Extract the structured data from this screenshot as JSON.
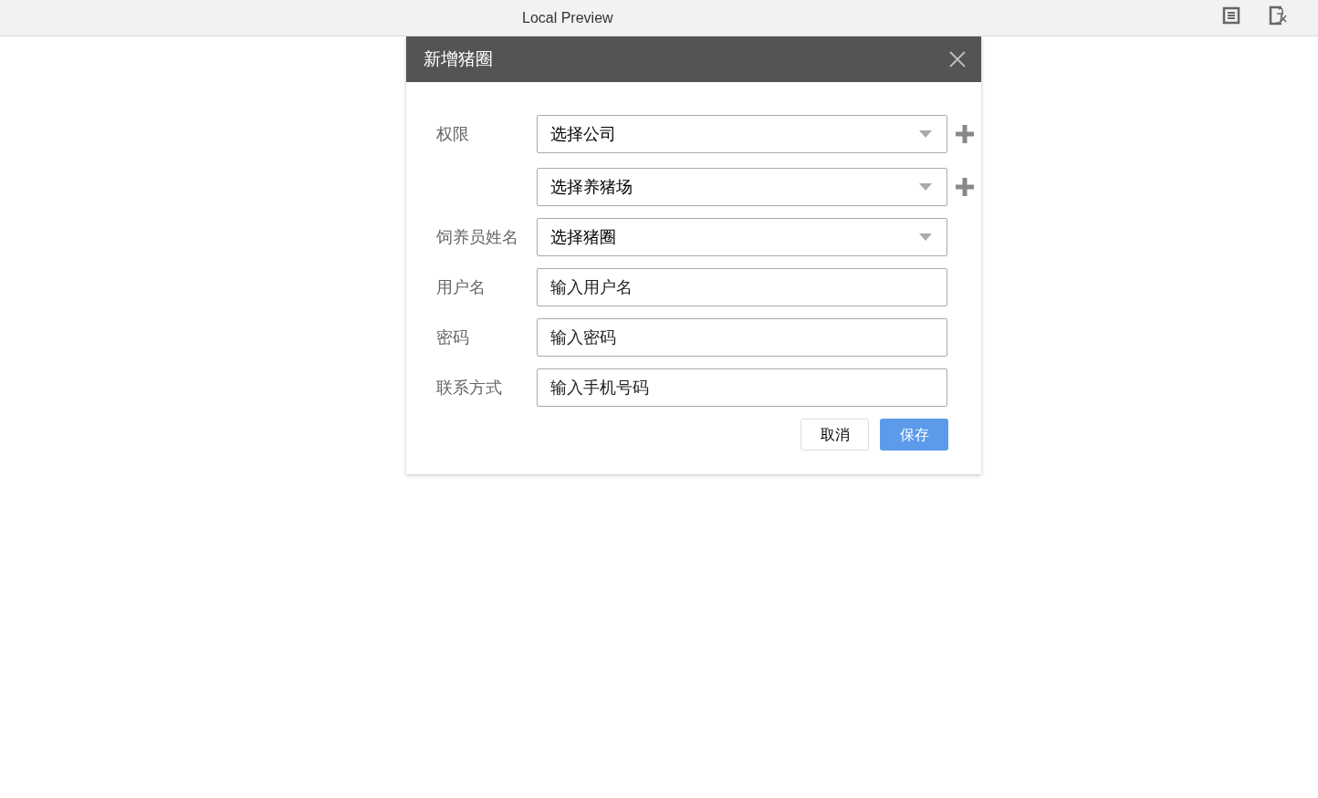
{
  "window": {
    "title": "Local Preview"
  },
  "dialog": {
    "title": "新增猪圈",
    "fields": [
      {
        "kind": "select",
        "label": "权限",
        "value": "选择公司",
        "add_button": true
      },
      {
        "kind": "select",
        "value": "选择养猪场",
        "add_button": true
      },
      {
        "kind": "select",
        "label": "饲养员姓名",
        "value": "选择猪圈",
        "add_button": false
      },
      {
        "kind": "input",
        "label": "用户名",
        "placeholder": "输入用户名"
      },
      {
        "kind": "input",
        "label": "密码",
        "placeholder": "输入密码"
      },
      {
        "kind": "input",
        "label": "联系方式",
        "placeholder": "输入手机号码"
      }
    ],
    "buttons": [
      {
        "label": "取消",
        "primary": false
      },
      {
        "label": "保存",
        "primary": true
      }
    ]
  }
}
